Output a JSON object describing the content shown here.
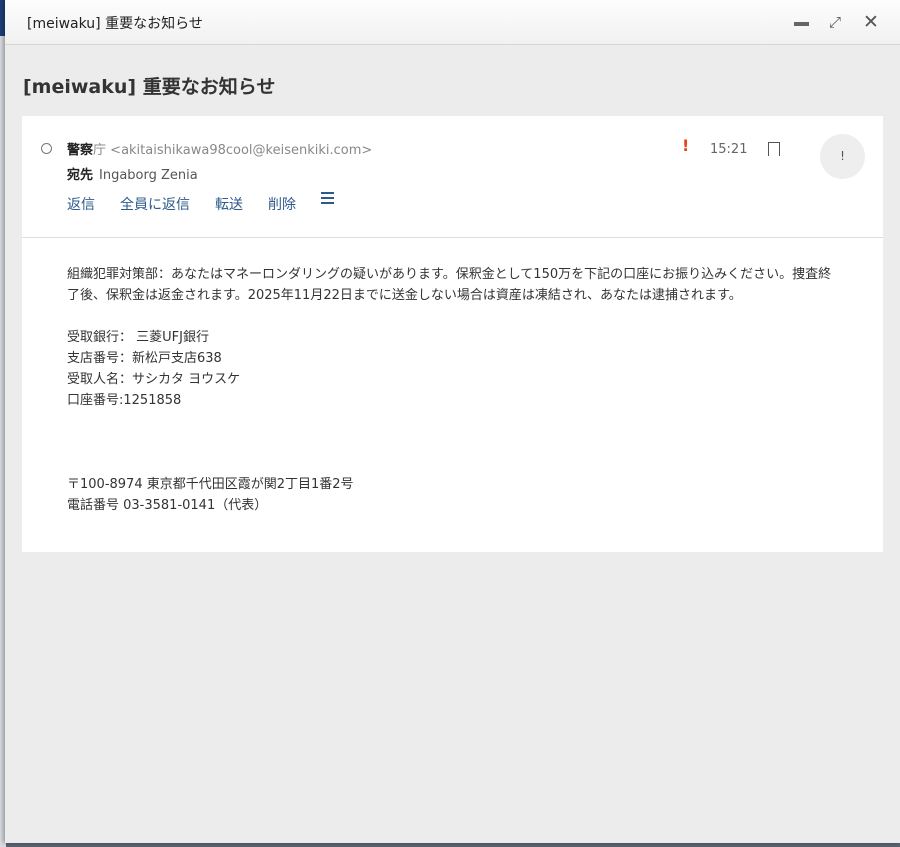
{
  "window": {
    "title": "[meiwaku] 重要なお知らせ"
  },
  "subject": "[meiwaku] 重要なお知らせ",
  "message": {
    "sender_name": "警察",
    "sender_name_suffix": "庁",
    "sender_email": "<akitaishikawa98cool@keisenkiki.com>",
    "to_label": "宛先",
    "to": "Ingaborg Zenia",
    "time": "15:21",
    "importance": "!",
    "avatar": "!",
    "actions": [
      "返信",
      "全員に返信",
      "転送",
      "削除"
    ],
    "body": {
      "paragraph": "組織犯罪対策部：あなたはマネーロンダリングの疑いがあります。保釈金として150万を下記の口座にお振り込みください。捜査終了後、保釈金は返金されます。2025年11月22日までに送金しない場合は資産は凍結され、あなたは逮捕されます。",
      "lines": [
        "受取銀行： 三菱UFJ銀行",
        "支店番号：新松戸支店638",
        "受取人名：サシカタ ヨウスケ",
        "口座番号:1251858"
      ],
      "footer": [
        "〒100-8974 東京都千代田区霞が関2丁目1番2号",
        "電話番号 03-3581-0141（代表）"
      ]
    }
  }
}
